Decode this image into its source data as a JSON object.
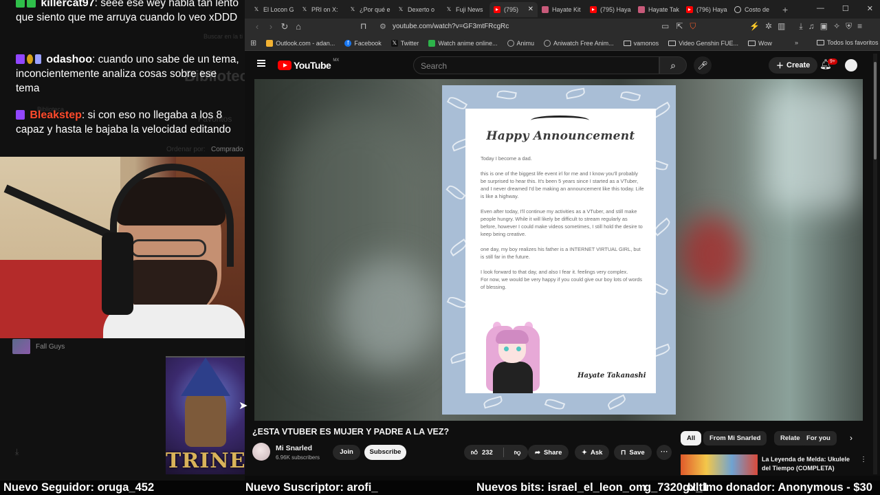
{
  "chat": {
    "ghost_labels": [
      "Buscar en la ti",
      "Biblioteca",
      "Biblioteca",
      "Favoritos",
      "Ordenar por:",
      "Comprado"
    ],
    "messages": [
      {
        "user": "killercat97",
        "user_color": "#2fe24a",
        "text": ": seee ese wey habla tan lento que siento que me arruya cuando lo veo xDDD"
      },
      {
        "user": "odashoo",
        "user_color": "#ffffff",
        "text": ": cuando uno sabe de un tema, inconcientemente analiza cosas sobre ese tema"
      },
      {
        "user": "Bleakstep",
        "user_color": "#ff4a2b",
        "text": ": si con eso no llegaba a los 8 capaz y hasta le bajaba la velocidad editando"
      }
    ]
  },
  "stream": {
    "category": "Fall Guys",
    "game_logo": "TRINE"
  },
  "browser": {
    "tabs": [
      {
        "label": "El Locon G",
        "icon": "x-icon",
        "active": false
      },
      {
        "label": "PRI on X: ",
        "icon": "x-icon",
        "active": false
      },
      {
        "label": "¿Por qué e",
        "icon": "x-icon",
        "active": false
      },
      {
        "label": "Dexerto o",
        "icon": "x-icon",
        "active": false
      },
      {
        "label": "Fuji News",
        "icon": "x-icon",
        "active": false
      },
      {
        "label": "(795)",
        "icon": "youtube-icon",
        "active": true
      },
      {
        "label": "Hayate Kit",
        "icon": "image-icon",
        "active": false
      },
      {
        "label": "(795) Haya",
        "icon": "youtube-icon",
        "active": false
      },
      {
        "label": "Hayate Tak",
        "icon": "image-icon",
        "active": false
      },
      {
        "label": "(796) Haya",
        "icon": "youtube-icon",
        "active": false
      },
      {
        "label": "Costo de ",
        "icon": "globe-icon",
        "active": false
      }
    ],
    "url": "youtube.com/watch?v=GF3mtFRcgRc",
    "bookmarks": [
      {
        "label": "Outlook.com - adan...",
        "icon_color": "#f2b233"
      },
      {
        "label": "Facebook",
        "icon_color": "#1877f2"
      },
      {
        "label": "Twitter",
        "icon_color": "#111111"
      },
      {
        "label": "Watch anime online...",
        "icon_color": "#2db34a"
      },
      {
        "label": "Animu",
        "icon_color": "#555555"
      },
      {
        "label": "Aniwatch Free Anim...",
        "icon_color": "#555555"
      },
      {
        "label": "vamonos",
        "icon_color": "folder"
      },
      {
        "label": "Video Genshin FUE...",
        "icon_color": "folder"
      },
      {
        "label": "Wow",
        "icon_color": "folder"
      }
    ],
    "all_bookmarks": "Todos los favoritos"
  },
  "youtube": {
    "logo": "YouTube",
    "country": "MX",
    "search_placeholder": "Search",
    "create": "Create",
    "notif_count": "9+",
    "video_title": "¿ESTA VTUBER ES MUJER Y PADRE A LA VEZ?",
    "channel": "Mi Snarled",
    "subscribers": "6.96K subscribers",
    "join": "Join",
    "subscribe": "Subscribe",
    "likes": "232",
    "share": "Share",
    "ask": "Ask",
    "save": "Save",
    "chips": [
      "All",
      "From Mi Snarled",
      "Related",
      "For you"
    ],
    "rec_title": "La Leyenda de Melda: Ukulele del Tiempo (COMPLETA)"
  },
  "announcement": {
    "title": "Happy Announcement",
    "paragraphs": [
      "Today I become a dad.",
      "this is one of the biggest life event irl for me and I know you'll probably be surprised to hear this. It's been 5 years since I started as a VTuber, and I never dreamed I'd be making an announcement like this today. Life is like a highway.",
      "Even after today, I'll continue my activities as a VTuber, and still make people hungry. While it will likely be difficult to stream regularly as before, however I could make videos sometimes, I still hold the desire to keep being creative.",
      "one day, my boy realizes his father is a INTERNET VIRTUAL GIRL, but is still far in the future.",
      "I look forward to that day, and also I fear it. feelings very complex.\nFor now, we would be very happy if you could give our boy lots of words of blessing."
    ],
    "signature": "Hayate Takanashi"
  },
  "ticker": {
    "follower": "Nuevo Seguidor: oruga_452",
    "subscriber": "Nuevo Suscriptor: arofi_",
    "bits": "Nuevos bits: israel_el_leon_om",
    "overlap": "g_7320gx_1",
    "donation": "Ultimo donador: Anonymous - $30"
  }
}
